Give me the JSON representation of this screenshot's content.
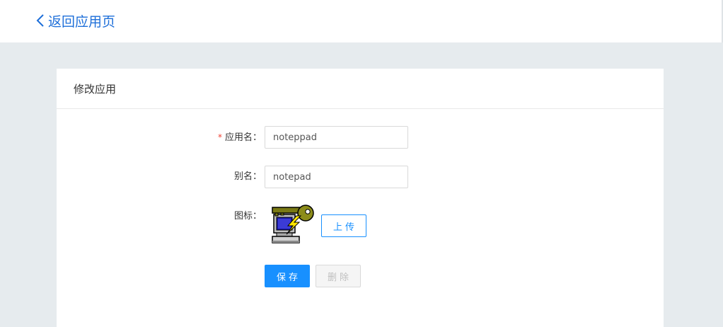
{
  "header": {
    "back_label": "返回应用页",
    "back_icon": "chevron-left-icon"
  },
  "card": {
    "title": "修改应用"
  },
  "form": {
    "app_name": {
      "required_mark": "*",
      "label": "应用名：",
      "value": "noteppad"
    },
    "alias": {
      "label": "别名：",
      "value": "notepad"
    },
    "icon": {
      "label": "图标：",
      "icon_name": "key-computer-icon",
      "upload_label": "上传"
    }
  },
  "actions": {
    "save_label": "保存",
    "delete_label": "删除"
  },
  "colors": {
    "accent": "#1890ff",
    "link": "#1e6fd9",
    "required": "#f04134",
    "background": "#e6ebee"
  }
}
